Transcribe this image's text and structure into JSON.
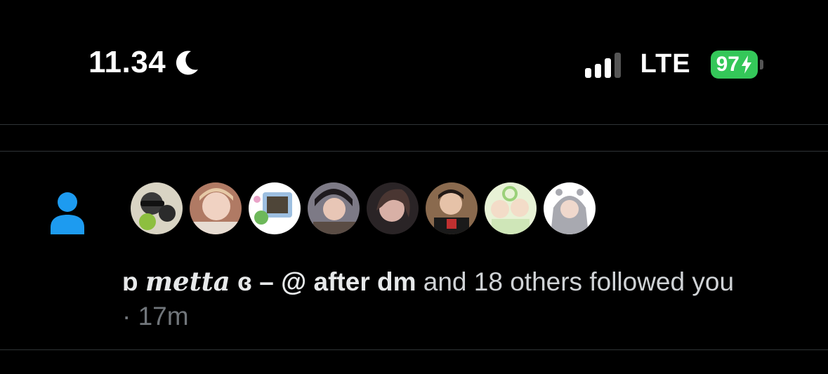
{
  "status_bar": {
    "time": "11.34",
    "moon_icon": "moon-icon",
    "network": "LTE",
    "battery_percent": "97",
    "battery_color": "#34c759",
    "signal_bars_active": 3,
    "signal_bars_total": 4
  },
  "notification": {
    "icon": "person-icon",
    "icon_color": "#1d9bf0",
    "user_prefix": "ɒ",
    "user_fancy": "metta",
    "user_suffix": "ɞ – @ after dm",
    "rest": " and 18 others followed you",
    "separator": "·",
    "time_ago": "17m",
    "avatars": [
      {
        "label": "follower-1"
      },
      {
        "label": "follower-2"
      },
      {
        "label": "follower-3"
      },
      {
        "label": "follower-4"
      },
      {
        "label": "follower-5"
      },
      {
        "label": "follower-6"
      },
      {
        "label": "follower-7"
      },
      {
        "label": "follower-8"
      }
    ]
  }
}
